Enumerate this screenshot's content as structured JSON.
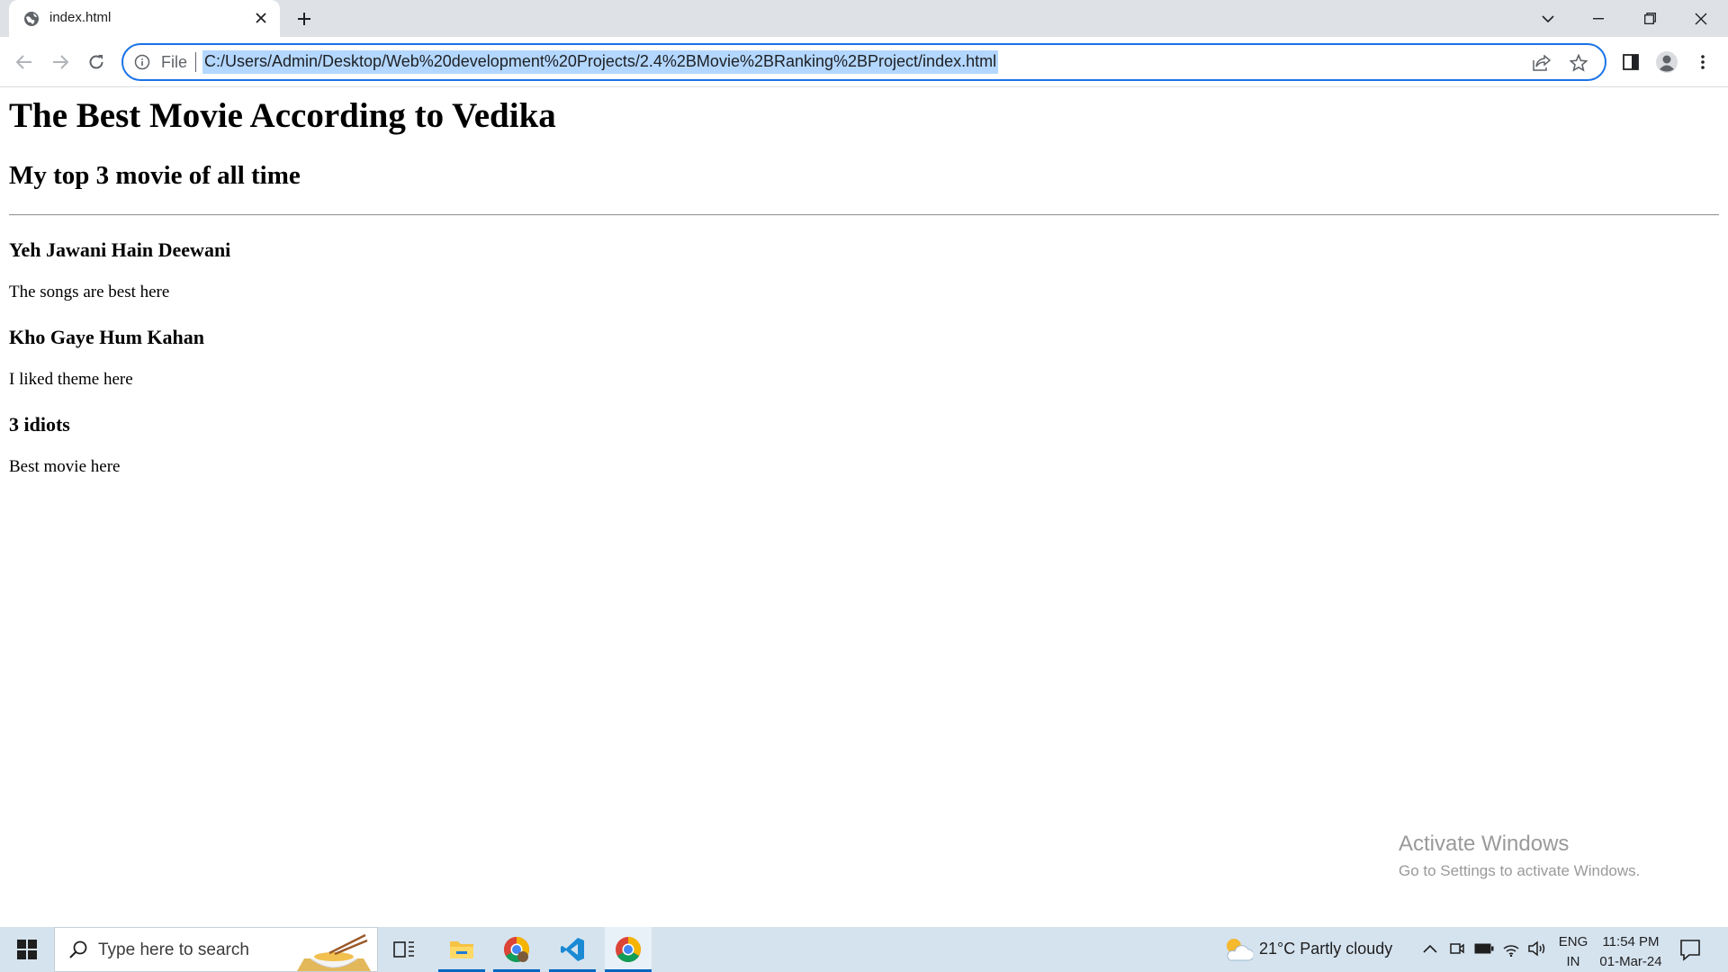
{
  "browser": {
    "tab_title": "index.html",
    "omnibox_scheme_label": "File",
    "url": "C:/Users/Admin/Desktop/Web%20development%20Projects/2.4%2BMovie%2BRanking%2BProject/index.html"
  },
  "page": {
    "heading": "The Best Movie According to Vedika",
    "subheading": "My top 3 movie of all time",
    "movies": [
      {
        "title": "Yeh Jawani Hain Deewani",
        "comment": "The songs are best here"
      },
      {
        "title": "Kho Gaye Hum Kahan",
        "comment": "I liked theme here"
      },
      {
        "title": "3 idiots",
        "comment": "Best movie here"
      }
    ]
  },
  "watermark": {
    "title": "Activate Windows",
    "subtitle": "Go to Settings to activate Windows."
  },
  "taskbar": {
    "search_placeholder": "Type here to search",
    "weather": "21°C  Partly cloudy",
    "language_top": "ENG",
    "language_bottom": "IN",
    "time": "11:54 PM",
    "date": "01-Mar-24"
  },
  "colors": {
    "tab_strip": "#dee1e6",
    "focus_ring": "#1a73e8",
    "url_selection": "#b3d7ff",
    "taskbar": "#d5e3ef"
  },
  "icons": {
    "tab_favicon": "globe-icon",
    "omnibox_info": "info-icon",
    "share": "share-icon",
    "bookmark": "star-icon",
    "side_panel": "side-panel-icon",
    "profile": "profile-icon",
    "menu": "kebab-menu-icon"
  }
}
